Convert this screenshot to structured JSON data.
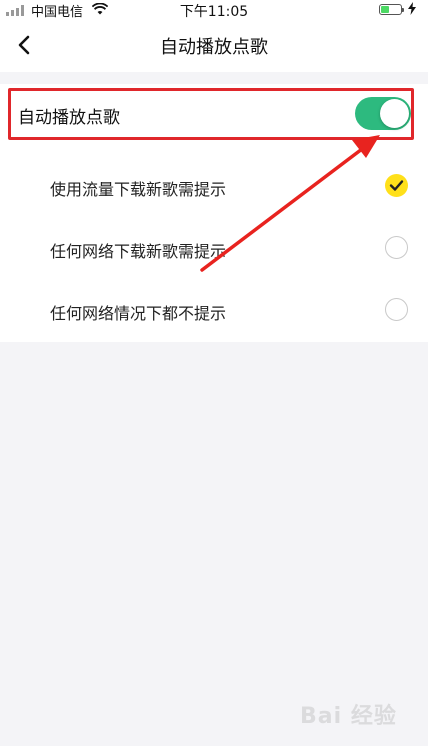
{
  "status_bar": {
    "carrier": "中国电信",
    "time": "下午11:05"
  },
  "nav": {
    "title": "自动播放点歌",
    "back_icon": "chevron-left-icon"
  },
  "auto_play": {
    "label": "自动播放点歌",
    "enabled": true,
    "switch_color": "#2dba7f"
  },
  "options": [
    {
      "label": "使用流量下载新歌需提示",
      "selected": true
    },
    {
      "label": "任何网络下载新歌需提示",
      "selected": false
    },
    {
      "label": "任何网络情况下都不提示",
      "selected": false
    }
  ],
  "colors": {
    "highlight_box": "#e0272b",
    "selected_radio": "#ffe01a"
  },
  "watermark": "Bai 经验"
}
